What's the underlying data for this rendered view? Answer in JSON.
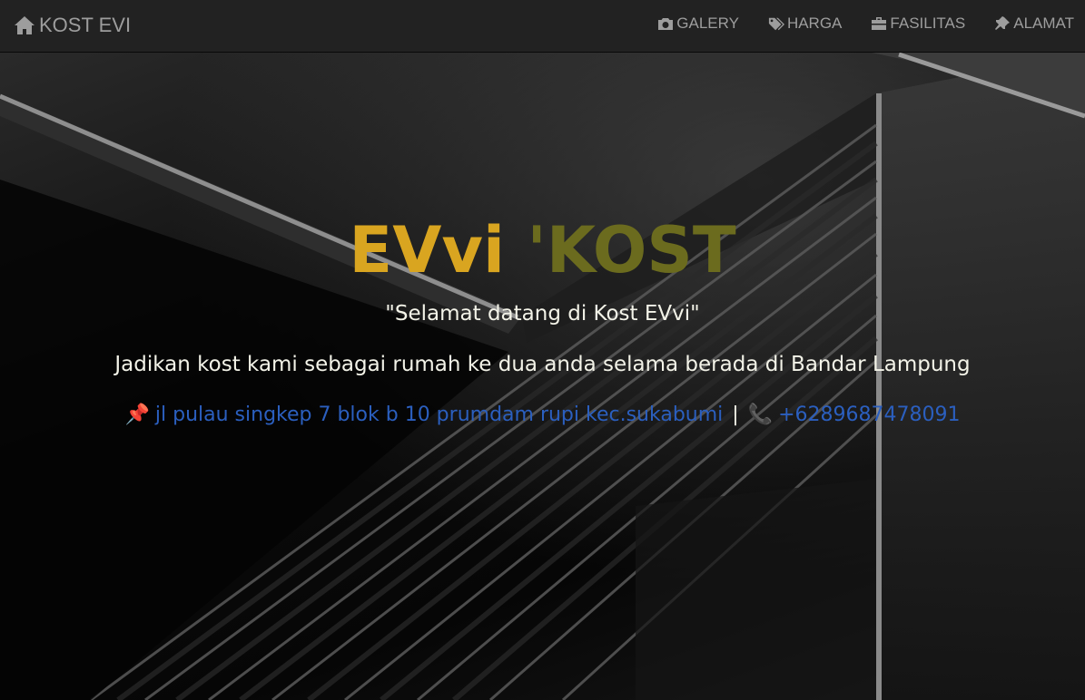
{
  "navbar": {
    "brand": "KOST EVI",
    "brand_icon": "home-icon",
    "items": [
      {
        "label": "GALERY",
        "icon": "camera-icon"
      },
      {
        "label": "HARGA",
        "icon": "tags-icon"
      },
      {
        "label": "FASILITAS",
        "icon": "briefcase-icon"
      },
      {
        "label": "ALAMAT",
        "icon": "pushpin-icon"
      }
    ]
  },
  "hero": {
    "title_part1": "EVvi",
    "title_part2": "'KOST",
    "welcome": "\"Selamat datang di Kost EVvi\"",
    "tagline": "Jadikan kost kami sebagai rumah ke dua anda selama berada di Bandar Lampung",
    "address": "jl pulau singkep 7 blok b 10 prumdam rupi kec.sukabumi",
    "separator": "|",
    "phone": "+6289687478091"
  },
  "colors": {
    "title_gold": "#d9a520",
    "title_olive": "#6b6b1e",
    "link_blue": "#2b5fbf",
    "navbar_bg": "#222222",
    "navbar_text": "#9d9d9d"
  }
}
